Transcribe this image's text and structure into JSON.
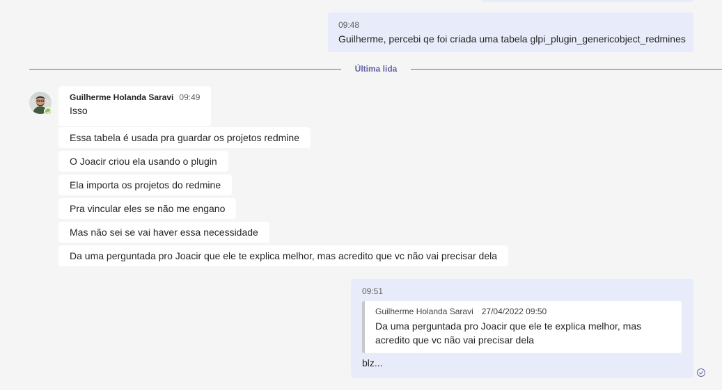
{
  "messages_out": [
    {
      "time": "09:48",
      "text": "Guilherme, percebi qe foi criada uma tabela glpi_plugin_genericobject_redmines"
    }
  ],
  "divider": {
    "label": "Última lida"
  },
  "incoming": {
    "sender": "Guilherme Holanda Saravi",
    "time": "09:49",
    "avatar_icon": "user-avatar-photo",
    "presence": "available",
    "presence_color": "#92c353",
    "messages": [
      "Isso",
      "Essa tabela é usada pra guardar os projetos redmine",
      "O Joacir criou ela usando o plugin",
      "Ela importa os projetos do redmine",
      "Pra vincular eles se não me engano",
      "Mas não sei se vai haver essa necessidade",
      "Da uma perguntada pro Joacir que ele te explica melhor, mas acredito que vc não vai precisar dela"
    ]
  },
  "reply": {
    "time": "09:51",
    "quote": {
      "sender": "Guilherme Holanda Saravi",
      "datetime": "27/04/2022 09:50",
      "text": "Da uma perguntada pro Joacir que ele te explica melhor, mas acredito que vc não vai precisar dela"
    },
    "text": "blz..."
  },
  "status_icon": "read-receipt-icon",
  "colors": {
    "background": "#f5f5f5",
    "outgoing_bubble": "#e8ebfa",
    "incoming_bubble": "#ffffff",
    "accent": "#6264a7"
  }
}
